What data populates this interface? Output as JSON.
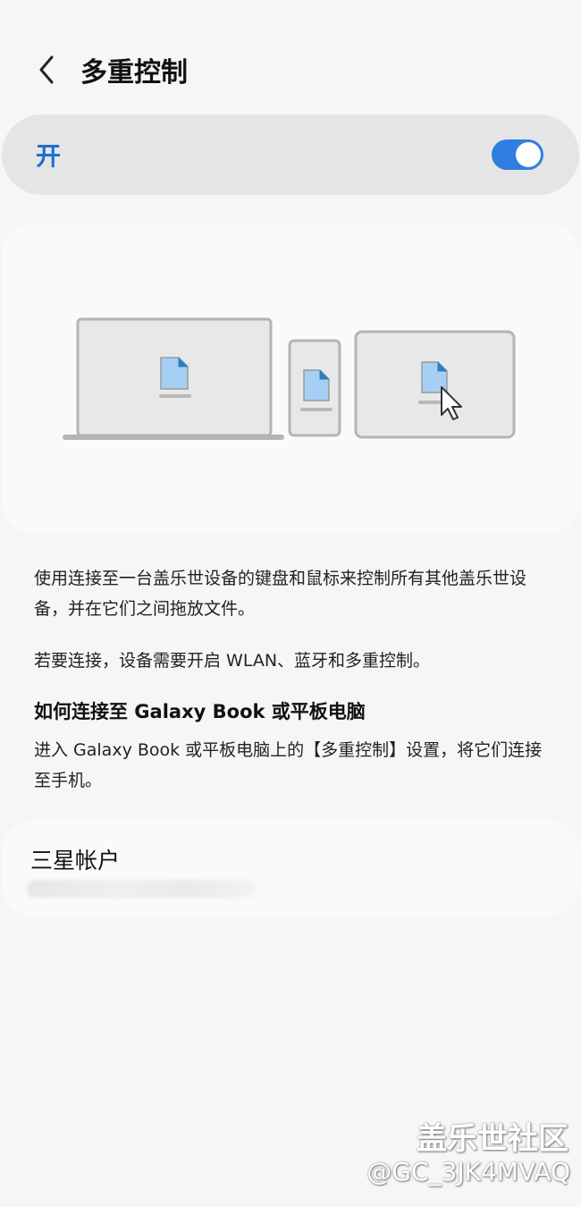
{
  "header": {
    "title": "多重控制"
  },
  "master_switch": {
    "label": "开",
    "state": "on",
    "accent": "#2f7ee0"
  },
  "description": {
    "paragraph1": "使用连接至一台盖乐世设备的键盘和鼠标来控制所有其他盖乐世设备，并在它们之间拖放文件。",
    "paragraph2": "若要连接，设备需要开启 WLAN、蓝牙和多重控制。",
    "how_to_title": "如何连接至 Galaxy Book 或平板电脑",
    "how_to_text": "进入 Galaxy Book 或平板电脑上的【多重控制】设置，将它们连接至手机。"
  },
  "account": {
    "title": "三星帐户"
  },
  "watermark": {
    "title": "盖乐世社区",
    "user": "@GC_3JK4MVAQ"
  },
  "icons": [
    "back-chevron-icon",
    "laptop-icon",
    "phone-icon",
    "tablet-icon",
    "document-icon",
    "mouse-cursor-icon"
  ]
}
